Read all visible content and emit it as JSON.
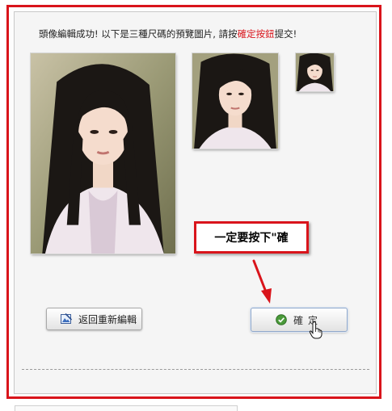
{
  "message": {
    "text_before": "頭像編輯成功! 以下是三種尺碼的預覽圖片, 請按",
    "highlight": "確定按鈕",
    "text_after": "提交!"
  },
  "previews": [
    {
      "name": "large"
    },
    {
      "name": "medium"
    },
    {
      "name": "small"
    }
  ],
  "callout": {
    "text": "一定要按下\"確"
  },
  "buttons": {
    "back_label": "返回重新編輯",
    "confirm_label": "確定"
  },
  "colors": {
    "accent_red": "#d9141b",
    "panel_bg": "#f5f5f5",
    "confirm_border": "#8fa7c9",
    "check_green": "#4a9a3a"
  },
  "icons": {
    "back": "image-edit-icon",
    "confirm": "check-circle-icon",
    "pointer": "hand-cursor-icon"
  }
}
